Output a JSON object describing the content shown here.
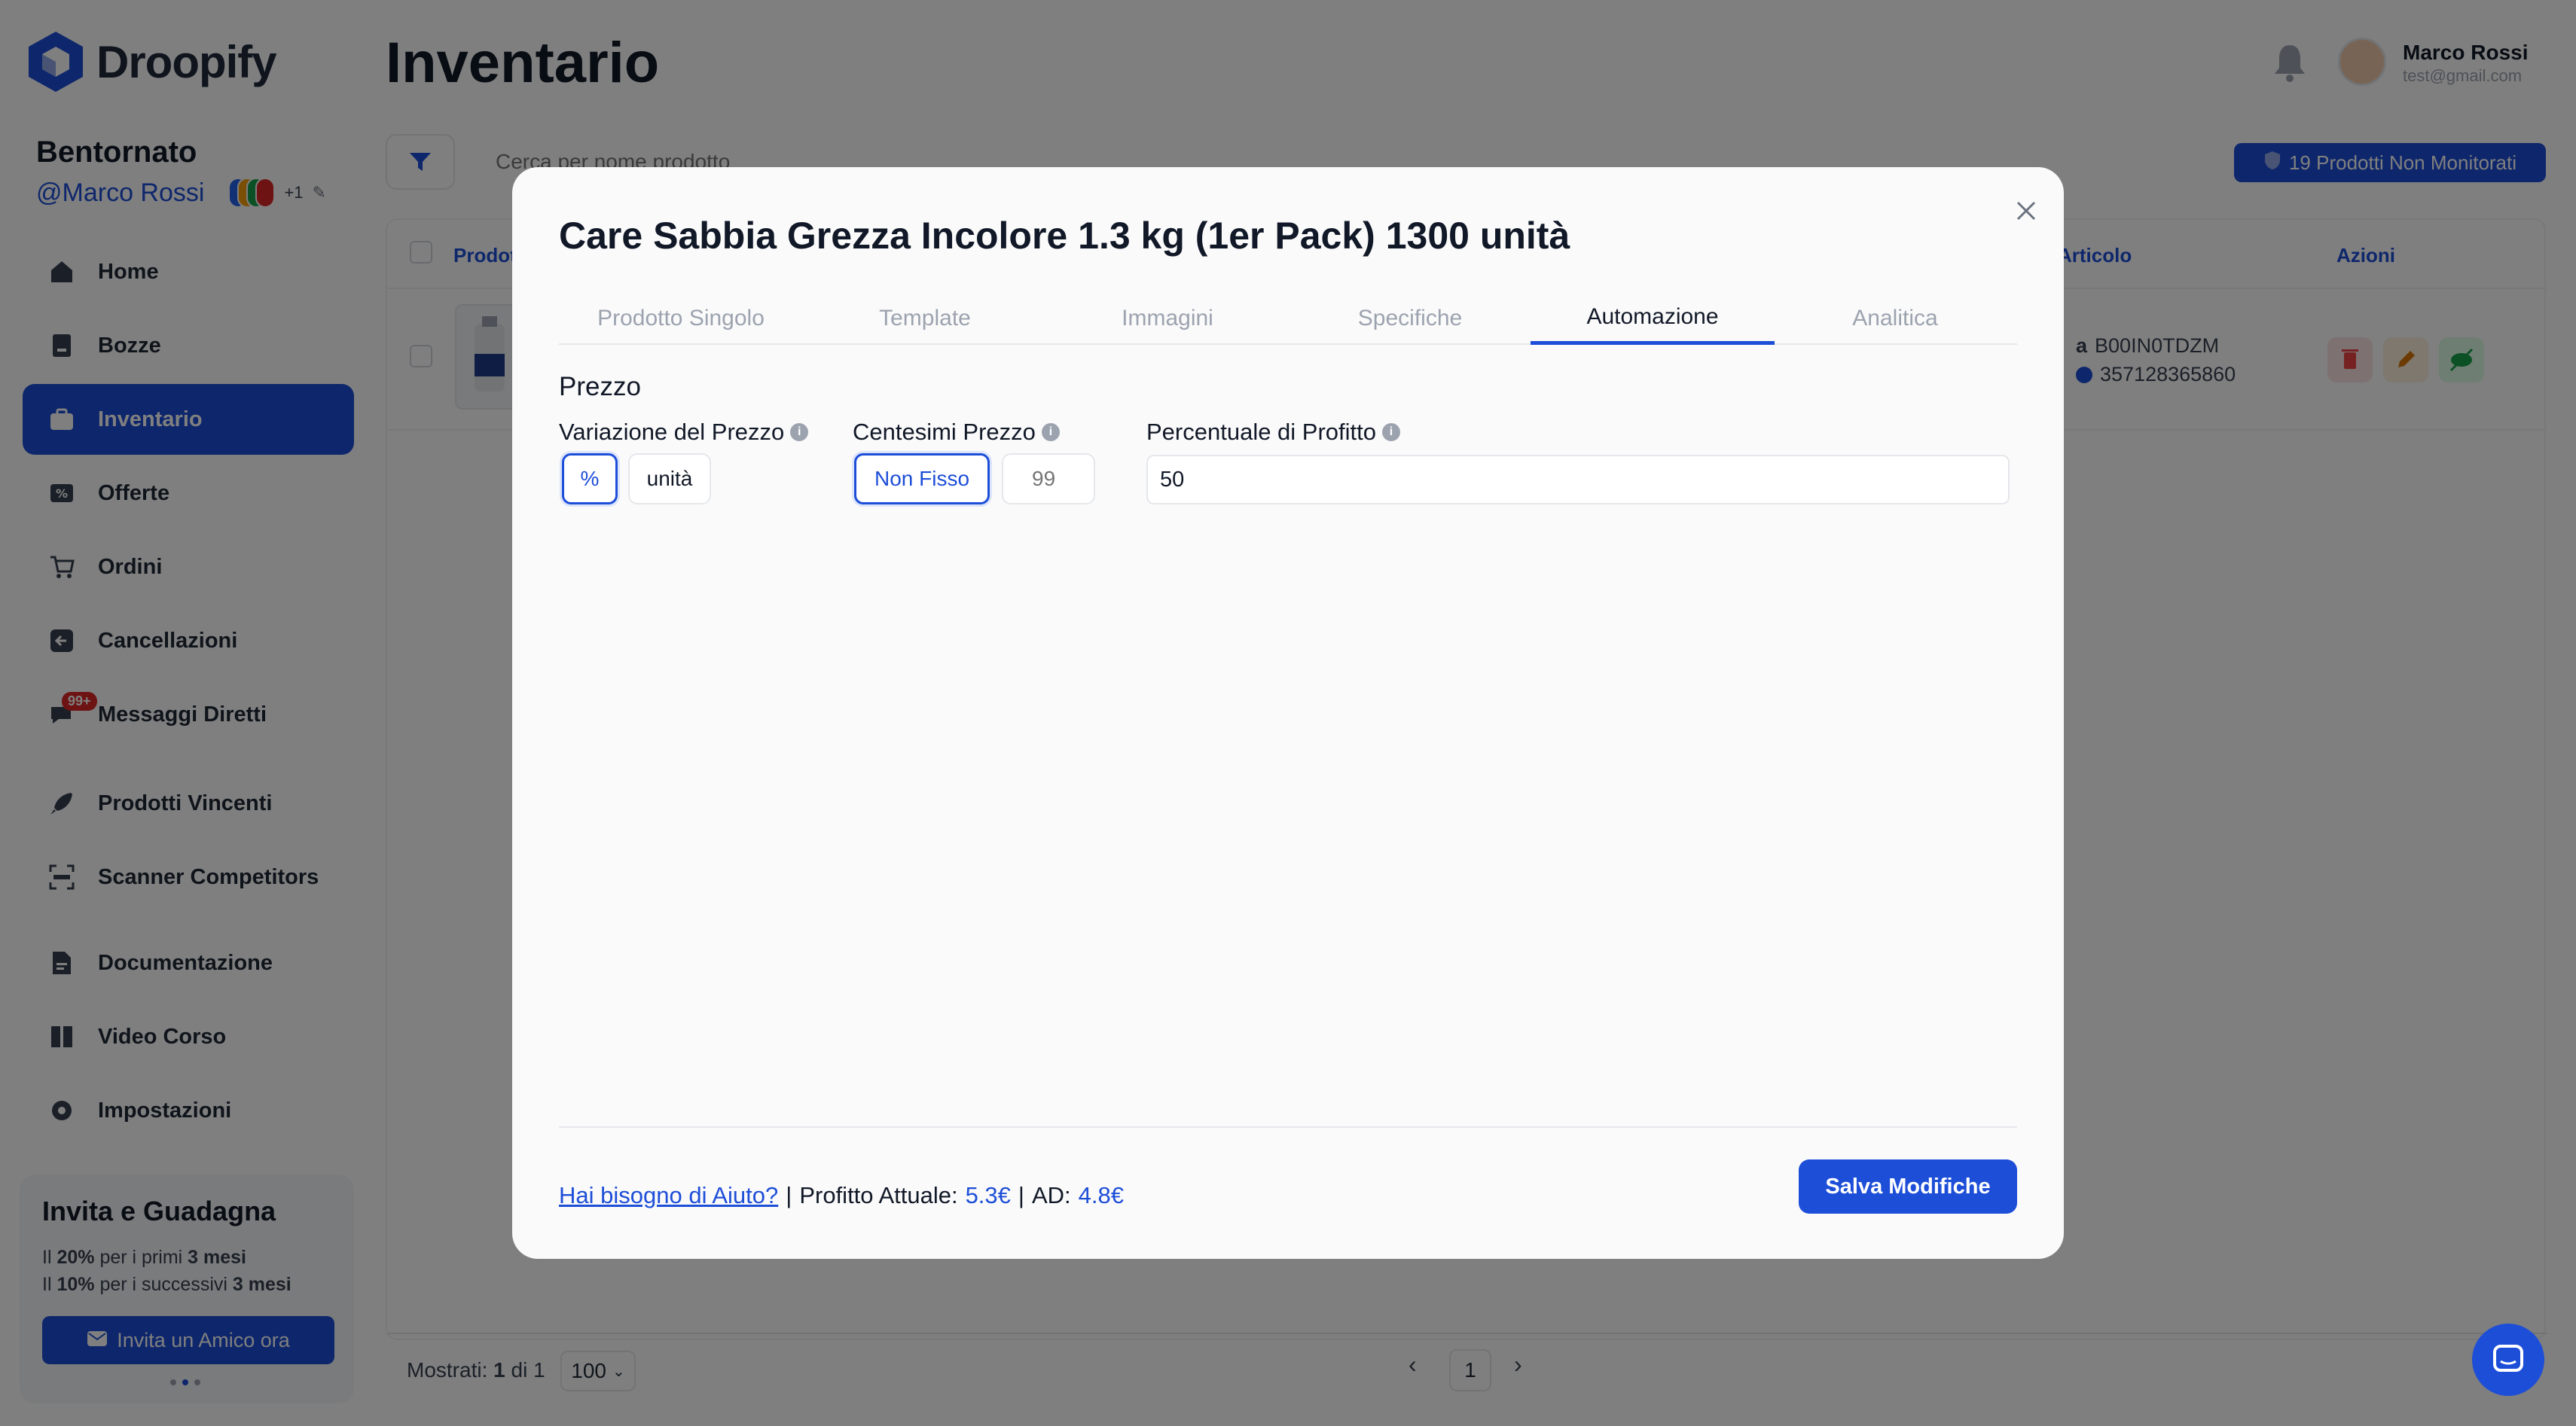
{
  "app": {
    "name": "Droopify"
  },
  "sidebar": {
    "welcome": "Bentornato",
    "user_handle": "@Marco Rossi",
    "marketplace_extra": "+1",
    "items": [
      {
        "label": "Home",
        "icon": "home-icon"
      },
      {
        "label": "Bozze",
        "icon": "drafts-icon"
      },
      {
        "label": "Inventario",
        "icon": "inventory-icon",
        "active": true
      },
      {
        "label": "Offerte",
        "icon": "offers-icon"
      },
      {
        "label": "Ordini",
        "icon": "cart-icon"
      },
      {
        "label": "Cancellazioni",
        "icon": "cancel-icon"
      },
      {
        "label": "Messaggi Diretti",
        "icon": "messages-icon",
        "badge": "99+"
      },
      {
        "label": "Prodotti Vincenti",
        "icon": "rocket-icon"
      },
      {
        "label": "Scanner Competitors",
        "icon": "scanner-icon"
      },
      {
        "label": "Documentazione",
        "icon": "document-icon"
      },
      {
        "label": "Video Corso",
        "icon": "book-icon"
      },
      {
        "label": "Impostazioni",
        "icon": "gear-icon"
      }
    ],
    "invite": {
      "title": "Invita e Guadagna",
      "line1_pre": "Il",
      "line1_pct": "20%",
      "line1_mid": "per i primi",
      "line1_dur": "3 mesi",
      "line2_pre": "Il",
      "line2_pct": "10%",
      "line2_mid": "per i successivi",
      "line2_dur": "3 mesi",
      "button": "Invita un Amico ora"
    }
  },
  "header": {
    "title": "Inventario",
    "user_name": "Marco Rossi",
    "user_email": "test@gmail.com"
  },
  "toolbar": {
    "search_placeholder": "Cerca per nome prodotto",
    "unmonitored_button": "19 Prodotti Non Monitorati"
  },
  "table": {
    "columns": {
      "product": "Prodotti",
      "article": "Articolo",
      "actions": "Azioni"
    },
    "rows": [
      {
        "asin": "B00IN0TDZM",
        "ean": "357128365860"
      }
    ]
  },
  "footer": {
    "shown_label": "Mostrati:",
    "shown_value": "1",
    "of_label": "di",
    "total": "1",
    "per_page": "100",
    "current_page": "1"
  },
  "modal": {
    "title": "Care Sabbia Grezza Incolore 1.3 kg (1er Pack) 1300 unità",
    "tabs": [
      "Prodotto Singolo",
      "Template",
      "Immagini",
      "Specifiche",
      "Automazione",
      "Analitica"
    ],
    "active_tab": "Automazione",
    "section_title": "Prezzo",
    "price_variation": {
      "label": "Variazione del Prezzo",
      "options": [
        "%",
        "unità"
      ],
      "selected": "%"
    },
    "price_cents": {
      "label": "Centesimi Prezzo",
      "option": "Non Fisso",
      "placeholder": "99"
    },
    "profit_pct": {
      "label": "Percentuale di Profitto",
      "value": "50"
    },
    "help_link": "Hai bisogno di Aiuto?",
    "current_profit_label": "Profitto Attuale:",
    "current_profit_value": "5.3€",
    "ad_label": "AD:",
    "ad_value": "4.8€",
    "save_button": "Salva Modifiche"
  },
  "colors": {
    "accent": "#1d4ed8",
    "overlay": "rgba(0,0,0,0.5)"
  }
}
